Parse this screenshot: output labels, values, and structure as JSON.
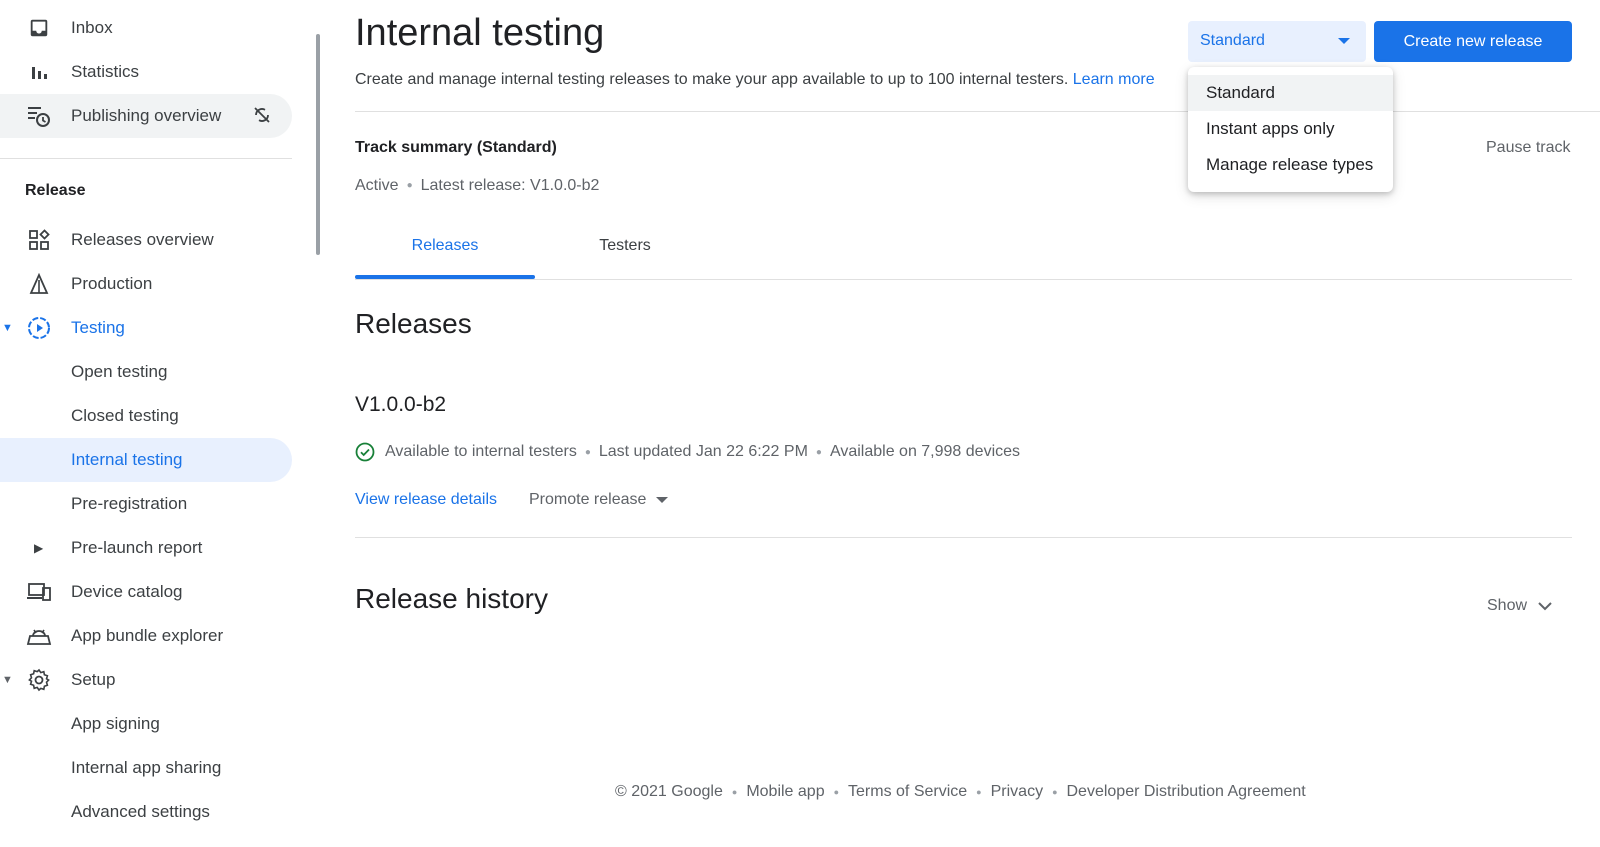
{
  "sidebar": {
    "inbox": "Inbox",
    "statistics": "Statistics",
    "publishing_overview": "Publishing overview",
    "section_release": "Release",
    "releases_overview": "Releases overview",
    "production": "Production",
    "testing": "Testing",
    "open_testing": "Open testing",
    "closed_testing": "Closed testing",
    "internal_testing": "Internal testing",
    "pre_registration": "Pre-registration",
    "pre_launch_report": "Pre-launch report",
    "device_catalog": "Device catalog",
    "app_bundle_explorer": "App bundle explorer",
    "setup": "Setup",
    "app_signing": "App signing",
    "internal_app_sharing": "Internal app sharing",
    "advanced_settings": "Advanced settings"
  },
  "header": {
    "title": "Internal testing",
    "description": "Create and manage internal testing releases to make your app available to up to 100 internal testers.",
    "learn_more": "Learn more",
    "select_value": "Standard",
    "create_button": "Create new release"
  },
  "dropdown": {
    "options": [
      "Standard",
      "Instant apps only",
      "Manage release types"
    ]
  },
  "track": {
    "summary": "Track summary (Standard)",
    "pause": "Pause track",
    "status": "Active",
    "latest_release": "Latest release: V1.0.0-b2"
  },
  "tabs": {
    "releases": "Releases",
    "testers": "Testers"
  },
  "releases": {
    "heading": "Releases",
    "version": "V1.0.0-b2",
    "availability": "Available to internal testers",
    "last_updated": "Last updated Jan 22 6:22 PM",
    "devices": "Available on 7,998 devices",
    "view_details": "View release details",
    "promote": "Promote release"
  },
  "history": {
    "heading": "Release history",
    "show": "Show"
  },
  "footer": {
    "copyright": "© 2021 Google",
    "mobile_app": "Mobile app",
    "terms": "Terms of Service",
    "privacy": "Privacy",
    "dda": "Developer Distribution Agreement"
  },
  "colors": {
    "accent": "#1a73e8",
    "active_bg": "#e8f0fe",
    "success": "#188038"
  }
}
